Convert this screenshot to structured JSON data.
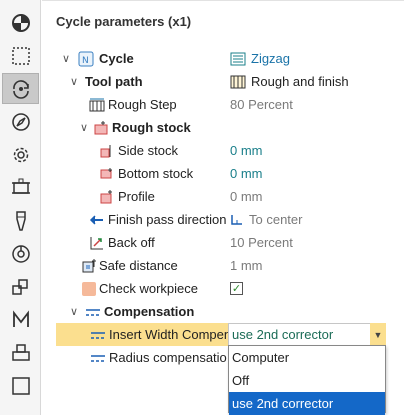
{
  "panel": {
    "title": "Cycle parameters (x1)"
  },
  "tree": {
    "cycle": {
      "label": "Cycle",
      "value": "Zigzag"
    },
    "tool_path": {
      "label": "Tool path",
      "value": "Rough and finish"
    },
    "rough_step": {
      "label": "Rough Step",
      "value": "80 Percent"
    },
    "rough_stock": {
      "label": "Rough stock"
    },
    "side_stock": {
      "label": "Side stock",
      "value": "0 mm"
    },
    "bottom_stock": {
      "label": "Bottom stock",
      "value": "0 mm"
    },
    "profile": {
      "label": "Profile",
      "value": "0 mm"
    },
    "finish_pass_direction": {
      "label": "Finish pass direction",
      "value": "To center"
    },
    "back_off": {
      "label": "Back off",
      "value": "10 Percent"
    },
    "safe_distance": {
      "label": "Safe distance",
      "value": "1 mm"
    },
    "check_workpiece": {
      "label": "Check workpiece",
      "checked": true
    },
    "compensation": {
      "label": "Compensation"
    },
    "insert_width_compensation": {
      "label": "Insert Width Compensation",
      "value": "use 2nd corrector"
    },
    "radius_compensation": {
      "label": "Radius compensation"
    }
  },
  "dropdown": {
    "options": [
      "Computer",
      "Off",
      "use 2nd corrector"
    ],
    "selected": "use 2nd corrector"
  },
  "toolbar": {
    "icons": [
      "pie-chart-icon",
      "dotted-square-icon",
      "rotate-icon",
      "compass-icon",
      "gear-icon",
      "clamp-icon",
      "tool-icon",
      "spindle-icon",
      "cubes-icon",
      "m-code-icon",
      "printer-icon",
      "square-icon"
    ],
    "active_index": 2
  },
  "colors": {
    "selection": "#fbdf8f",
    "accent": "#1468c8",
    "value_teal": "#1a7f8a"
  }
}
